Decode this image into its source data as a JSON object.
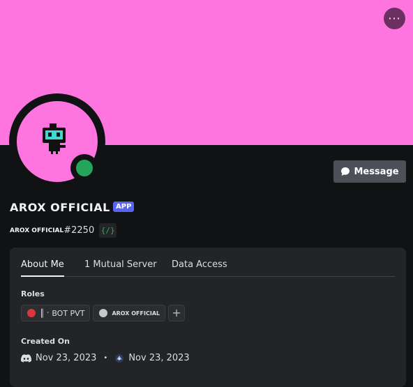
{
  "profile": {
    "display_name": "AROX OFFICIAL",
    "app_badge": "APP",
    "username": "AROX OFFICIAL",
    "discriminator": "#2250",
    "command_badge": "{/}",
    "banner_color": "#ff75df",
    "status_color": "#23a55a"
  },
  "actions": {
    "more": "···",
    "message": "Message"
  },
  "tabs": [
    {
      "label": "About Me",
      "active": true
    },
    {
      "label": "1 Mutual Server",
      "active": false
    },
    {
      "label": "Data Access",
      "active": false
    }
  ],
  "roles": {
    "label": "Roles",
    "items": [
      {
        "name": "║ ˑ BOT PVT",
        "color": "#da373c"
      },
      {
        "name": "AROX OFFICIAL",
        "color": "#c4c9ce"
      }
    ],
    "add": "+"
  },
  "created": {
    "label": "Created On",
    "discord_date": "Nov 23, 2023",
    "separator": "•",
    "server_date": "Nov 23, 2023"
  }
}
